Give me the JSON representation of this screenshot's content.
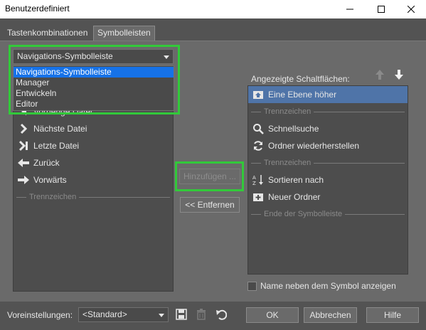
{
  "window": {
    "title": "Benutzerdefiniert"
  },
  "tabs": [
    {
      "label": "Tastenkombinationen"
    },
    {
      "label": "Symbolleisten"
    }
  ],
  "toolbar_select": {
    "value": "Navigations-Symbolleiste",
    "options": [
      "Navigations-Symbolleiste",
      "Manager",
      "Entwickeln",
      "Editor"
    ]
  },
  "available_list": {
    "items": [
      {
        "label": "Vorherige Datei",
        "icon": "previous-file-icon"
      },
      {
        "label": "Nächste Datei",
        "icon": "next-file-icon"
      },
      {
        "label": "Letzte Datei",
        "icon": "last-file-icon"
      },
      {
        "label": "Zurück",
        "icon": "back-arrow-icon"
      },
      {
        "label": "Vorwärts",
        "icon": "forward-arrow-icon"
      }
    ],
    "separator": "Trennzeichen"
  },
  "displayed": {
    "heading": "Angezeigte Schaltflächen:",
    "items": [
      {
        "type": "item",
        "label": "Eine Ebene höher",
        "icon": "folder-up-icon",
        "selected": true
      },
      {
        "type": "separator",
        "label": "Trennzeichen"
      },
      {
        "type": "item",
        "label": "Schnellsuche",
        "icon": "search-icon"
      },
      {
        "type": "item",
        "label": "Ordner wiederherstellen",
        "icon": "refresh-icon"
      },
      {
        "type": "separator",
        "label": "Trennzeichen"
      },
      {
        "type": "item",
        "label": "Sortieren nach",
        "icon": "sort-az-icon"
      },
      {
        "type": "item",
        "label": "Neuer Ordner",
        "icon": "new-folder-icon"
      },
      {
        "type": "separator",
        "label": "Ende der Symbolleiste"
      }
    ]
  },
  "buttons": {
    "add": "Hinzufügen ...",
    "remove": "<< Entfernen",
    "ok": "OK",
    "cancel": "Abbrechen",
    "help": "Hilfe"
  },
  "show_name_checkbox": {
    "label": "Name neben dem Symbol anzeigen",
    "checked": false
  },
  "presets": {
    "label": "Voreinstellungen:",
    "value": "<Standard>"
  },
  "colors": {
    "highlight": "#32c93a",
    "selection": "#4f74a8",
    "dropdown_active": "#1672e8"
  }
}
